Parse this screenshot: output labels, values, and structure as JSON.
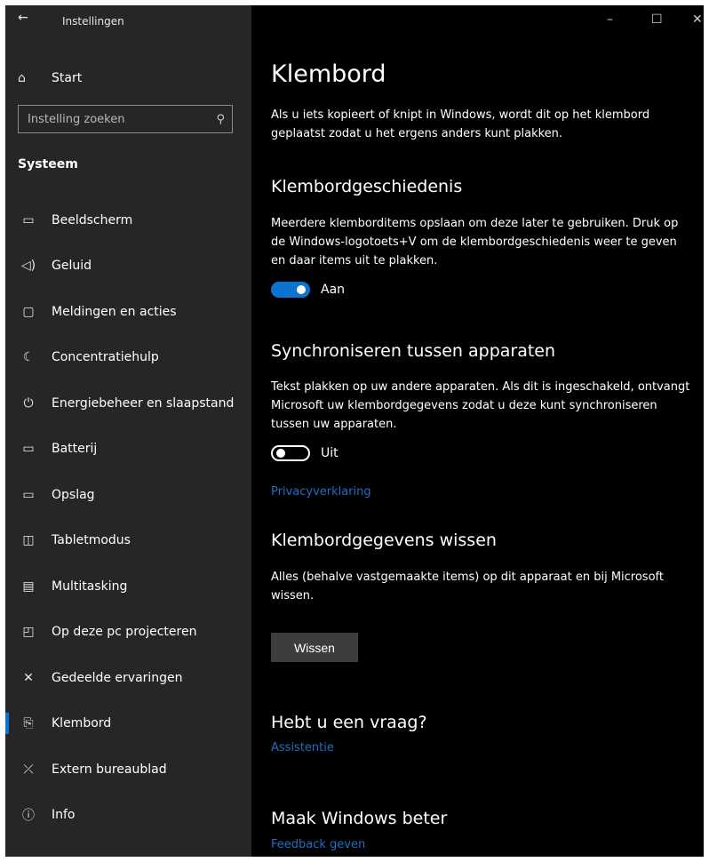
{
  "window": {
    "title": "Instellingen",
    "back_glyph": "←",
    "min_glyph": "–",
    "max_glyph": "☐",
    "close_glyph": "✕"
  },
  "sidebar": {
    "start_label": "Start",
    "search_placeholder": "Instelling zoeken",
    "section_title": "Systeem",
    "items": [
      {
        "label": "Beeldscherm",
        "icon": "monitor-icon",
        "glyph": "▭"
      },
      {
        "label": "Geluid",
        "icon": "speaker-icon",
        "glyph": "◁)"
      },
      {
        "label": "Meldingen en acties",
        "icon": "notification-icon",
        "glyph": "▢"
      },
      {
        "label": "Concentratiehulp",
        "icon": "moon-icon",
        "glyph": "☾"
      },
      {
        "label": "Energiebeheer en slaapstand",
        "icon": "power-icon",
        "glyph": "⏻"
      },
      {
        "label": "Batterij",
        "icon": "battery-icon",
        "glyph": "▭"
      },
      {
        "label": "Opslag",
        "icon": "storage-icon",
        "glyph": "▭"
      },
      {
        "label": "Tabletmodus",
        "icon": "tablet-mode-icon",
        "glyph": "◫"
      },
      {
        "label": "Multitasking",
        "icon": "multitasking-icon",
        "glyph": "▤"
      },
      {
        "label": "Op deze pc projecteren",
        "icon": "project-icon",
        "glyph": "◰"
      },
      {
        "label": "Gedeelde ervaringen",
        "icon": "shared-experiences-icon",
        "glyph": "✕"
      },
      {
        "label": "Klembord",
        "icon": "clipboard-icon",
        "glyph": "📋",
        "active": true
      },
      {
        "label": "Extern bureaublad",
        "icon": "remote-desktop-icon",
        "glyph": "⤫"
      },
      {
        "label": "Info",
        "icon": "info-icon",
        "glyph": "ⓘ"
      }
    ]
  },
  "main": {
    "title": "Klembord",
    "intro": "Als u iets kopieert of knipt in Windows, wordt dit op het klembord geplaatst zodat u het ergens anders kunt plakken.",
    "history": {
      "heading": "Klembordgeschiedenis",
      "description": "Meerdere klemborditems opslaan om deze later te gebruiken. Druk op de Windows-logotoets+V om de klembordgeschiedenis weer te geven en daar items uit te plakken.",
      "toggle_label": "Aan",
      "toggle_on": true
    },
    "sync": {
      "heading": "Synchroniseren tussen apparaten",
      "description": "Tekst plakken op uw andere apparaten. Als dit is ingeschakeld, ontvangt Microsoft uw klembordgegevens zodat u deze kunt synchroniseren tussen uw apparaten.",
      "toggle_label": "Uit",
      "toggle_on": false,
      "privacy_link": "Privacyverklaring"
    },
    "clear": {
      "heading": "Klembordgegevens wissen",
      "description": "Alles (behalve vastgemaakte items) op dit apparaat en bij Microsoft wissen.",
      "button_label": "Wissen"
    },
    "question": {
      "heading": "Hebt u een vraag?",
      "link": "Assistentie"
    },
    "improve": {
      "heading": "Maak Windows beter",
      "link": "Feedback geven"
    }
  },
  "colors": {
    "accent": "#0a74d0",
    "link": "#1f6fc2",
    "sidebar_bg": "#262626",
    "main_bg": "#000000"
  }
}
